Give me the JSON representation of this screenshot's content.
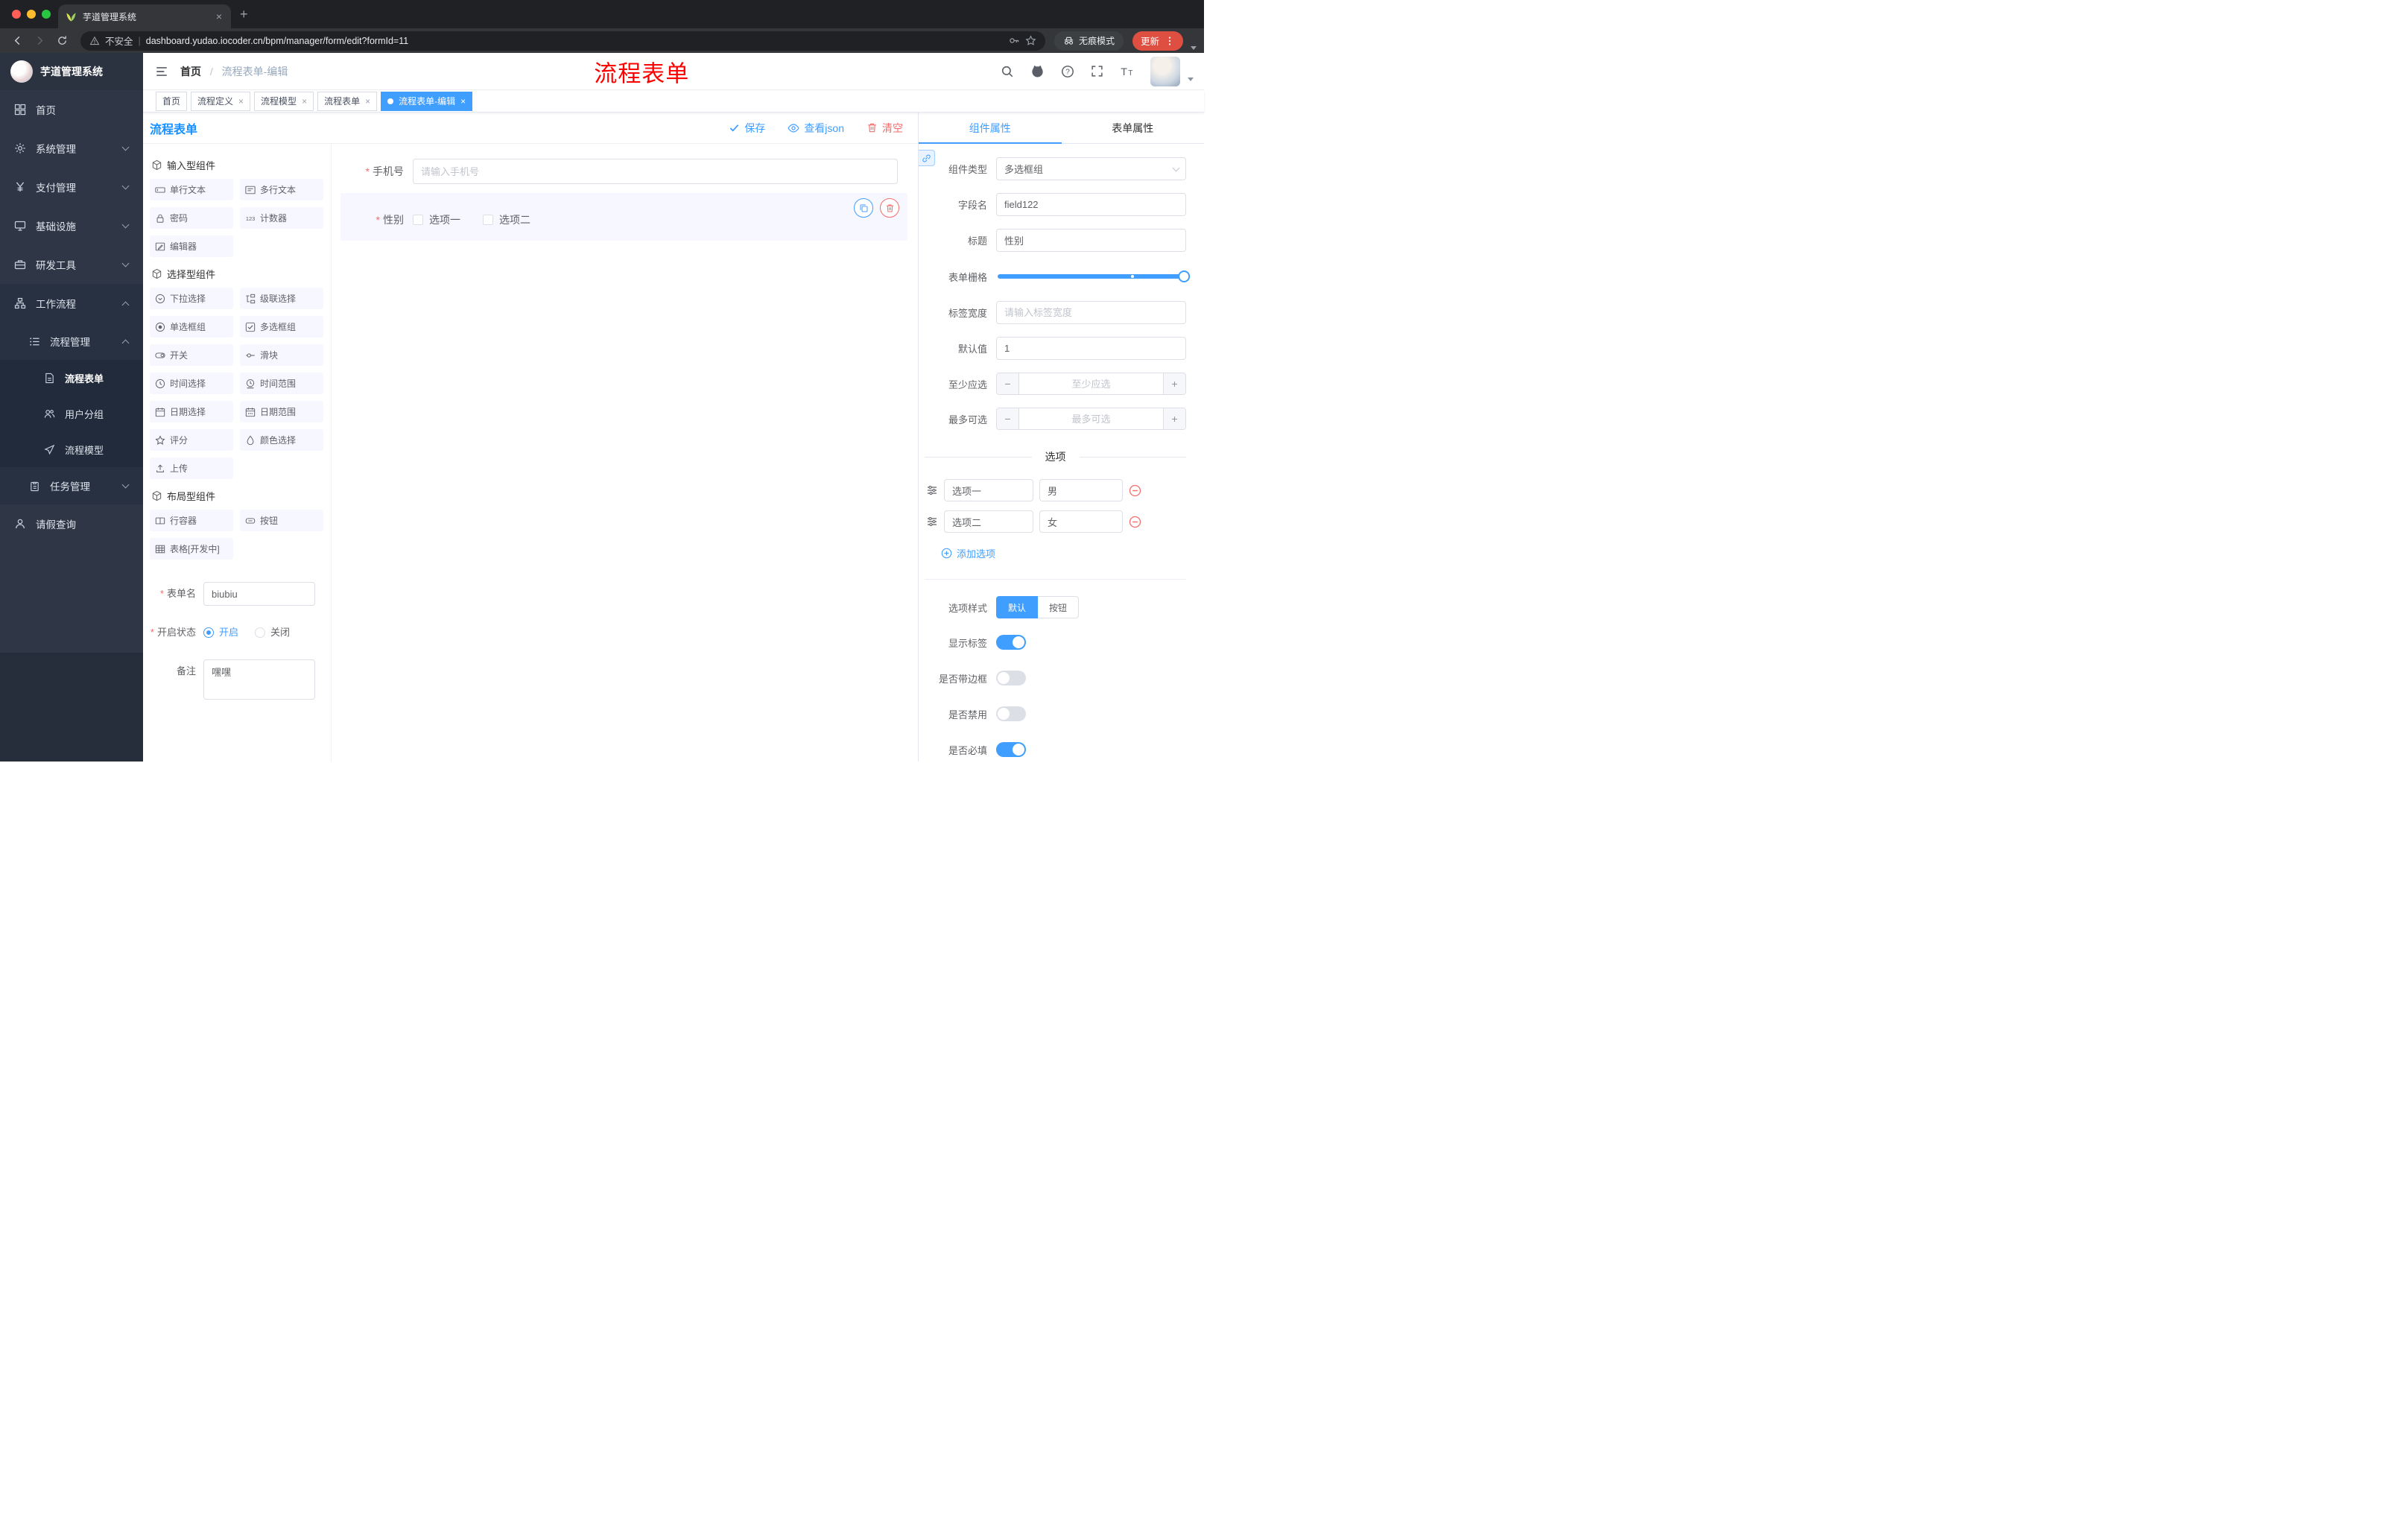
{
  "colors": {
    "accent": "#409eff",
    "danger": "#f56c6c",
    "annotation": "#fe0000",
    "update_button": "#de4e41"
  },
  "browser": {
    "tab_title": "芋道管理系统",
    "new_tab": "+",
    "security_label": "不安全",
    "url": "dashboard.yudao.iocoder.cn/bpm/manager/form/edit?formId=11",
    "incognito_label": "无痕模式",
    "update_label": "更新"
  },
  "sidebar": {
    "logo_title": "芋道管理系统",
    "items": [
      {
        "label": "首页"
      },
      {
        "label": "系统管理"
      },
      {
        "label": "支付管理"
      },
      {
        "label": "基础设施"
      },
      {
        "label": "研发工具"
      },
      {
        "label": "工作流程"
      },
      {
        "label": "流程管理"
      },
      {
        "label": "流程表单"
      },
      {
        "label": "用户分组"
      },
      {
        "label": "流程模型"
      },
      {
        "label": "任务管理"
      },
      {
        "label": "请假查询"
      }
    ]
  },
  "header": {
    "breadcrumb_home": "首页",
    "breadcrumb_current": "流程表单-编辑",
    "annotation": "流程表单"
  },
  "tags": [
    {
      "label": "首页"
    },
    {
      "label": "流程定义"
    },
    {
      "label": "流程模型"
    },
    {
      "label": "流程表单"
    },
    {
      "label": "流程表单-编辑"
    }
  ],
  "designer": {
    "title": "流程表单",
    "actions": {
      "save": "保存",
      "view_json": "查看json",
      "clear": "清空"
    },
    "groups": [
      {
        "title": "输入型组件",
        "items": [
          "单行文本",
          "多行文本",
          "密码",
          "计数器",
          "编辑器"
        ]
      },
      {
        "title": "选择型组件",
        "items": [
          "下拉选择",
          "级联选择",
          "单选框组",
          "多选框组",
          "开关",
          "滑块",
          "时间选择",
          "时间范围",
          "日期选择",
          "日期范围",
          "评分",
          "颜色选择",
          "上传"
        ]
      },
      {
        "title": "布局型组件",
        "items": [
          "行容器",
          "按钮",
          "表格[开发中]"
        ]
      }
    ],
    "meta": {
      "name_label": "表单名",
      "name_value": "biubiu",
      "status_label": "开启状态",
      "status_on": "开启",
      "status_off": "关闭",
      "remark_label": "备注",
      "remark_value": "嘿嘿"
    },
    "canvas": {
      "phone_label": "手机号",
      "phone_placeholder": "请输入手机号",
      "gender_label": "性别",
      "gender_option1": "选项一",
      "gender_option2": "选项二"
    }
  },
  "props": {
    "tab_component": "组件属性",
    "tab_form": "表单属性",
    "component_type_label": "组件类型",
    "component_type_value": "多选框组",
    "field_name_label": "字段名",
    "field_name_value": "field122",
    "title_label": "标题",
    "title_value": "性别",
    "grid_label": "表单栅格",
    "label_width_label": "标签宽度",
    "label_width_placeholder": "请输入标签宽度",
    "default_label": "默认值",
    "default_value": "1",
    "min_label": "至少应选",
    "min_placeholder": "至少应选",
    "max_label": "最多可选",
    "max_placeholder": "最多可选",
    "options_divider": "选项",
    "options": [
      {
        "label": "选项一",
        "value": "男"
      },
      {
        "label": "选项二",
        "value": "女"
      }
    ],
    "add_option": "添加选项",
    "style_label": "选项样式",
    "style_default": "默认",
    "style_button": "按钮",
    "switches": [
      {
        "label": "显示标签",
        "on": true
      },
      {
        "label": "是否带边框",
        "on": false
      },
      {
        "label": "是否禁用",
        "on": false
      },
      {
        "label": "是否必填",
        "on": true
      }
    ]
  }
}
